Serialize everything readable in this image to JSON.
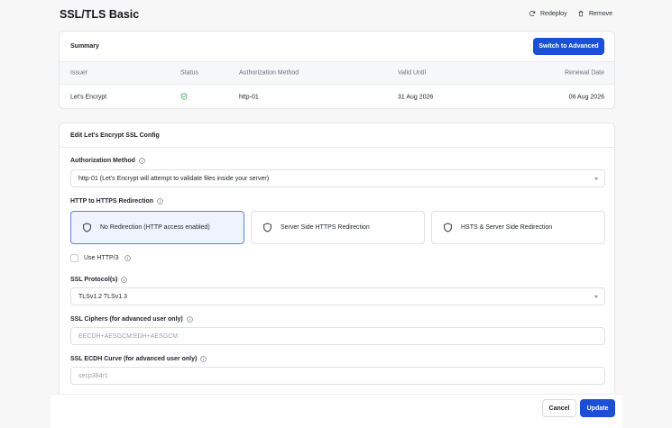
{
  "header": {
    "title": "SSL/TLS Basic",
    "redeploy_label": "Redeploy",
    "remove_label": "Remove"
  },
  "summary": {
    "title": "Summary",
    "switch_label": "Switch to Advanced",
    "columns": [
      "Issuer",
      "Status",
      "Authorization Method",
      "Valid Until",
      "Renewal Date"
    ],
    "row": {
      "issuer": "Let's Encrypt",
      "status_icon": "shield-check-icon",
      "method": "http-01",
      "valid_until": "31 Aug 2026",
      "renewal_date": "06 Aug 2026"
    }
  },
  "config": {
    "title": "Edit Let's Encrypt SSL Config",
    "auth_method_label": "Authorization Method",
    "auth_method_value": "http-01 (Let's Encrypt will attempt to validate files inside your server)",
    "redirect_label": "HTTP to HTTPS Redirection",
    "redirect_options": [
      "No Redirection (HTTP access enabled)",
      "Server Side HTTPS Redirection",
      "HSTS & Server Side Redirection"
    ],
    "redirect_selected": 0,
    "http3_label": "Use HTTP/3",
    "http3_checked": false,
    "protocols_label": "SSL Protocol(s)",
    "protocols_value": "TLSv1.2 TLSv1.3",
    "ciphers_label": "SSL Ciphers (for advanced user only)",
    "ciphers_placeholder": "EECDH+AESGCM:EDH+AESGCM",
    "ecdh_label": "SSL ECDH Curve (for advanced user only)",
    "ecdh_placeholder": "secp384r1"
  },
  "footer": {
    "cancel_label": "Cancel",
    "update_label": "Update"
  },
  "colors": {
    "accent": "#1a4fd6",
    "status_green": "#2fa35b"
  }
}
